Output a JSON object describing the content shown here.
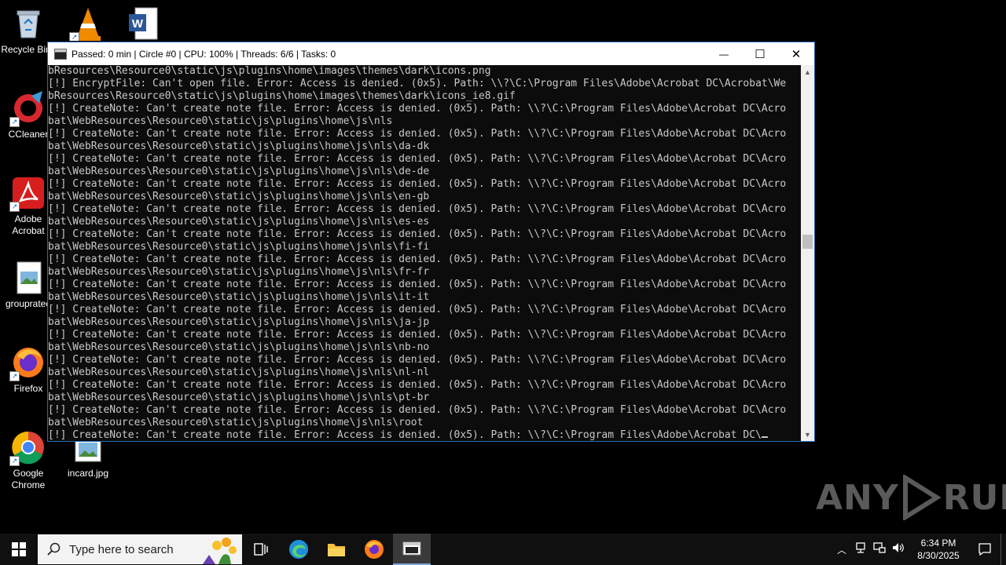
{
  "desktop": {
    "icons": [
      {
        "label": "Recycle Bin"
      },
      {
        "label": "VLC media player"
      },
      {
        "label": "Word document"
      },
      {
        "label": "CCleaner"
      },
      {
        "label": "Adobe Acrobat"
      },
      {
        "label": "grouprated"
      },
      {
        "label": "Firefox"
      },
      {
        "label": "Google Chrome"
      },
      {
        "label": "incard.jpg"
      }
    ]
  },
  "console_window": {
    "title": "Passed: 0 min | Circle #0 | CPU: 100% | Threads: 6/6 | Tasks: 0",
    "minimize_label": "—",
    "maximize_label": "☐",
    "close_label": "✕",
    "lines": [
      "bResources\\Resource0\\static\\js\\plugins\\home\\images\\themes\\dark\\icons.png",
      "[!] EncryptFile: Can't open file. Error: Access is denied. (0x5). Path: \\\\?\\C:\\Program Files\\Adobe\\Acrobat DC\\Acrobat\\We",
      "bResources\\Resource0\\static\\js\\plugins\\home\\images\\themes\\dark\\icons_ie8.gif",
      "[!] CreateNote: Can't create note file. Error: Access is denied. (0x5). Path: \\\\?\\C:\\Program Files\\Adobe\\Acrobat DC\\Acro",
      "bat\\WebResources\\Resource0\\static\\js\\plugins\\home\\js\\nls",
      "[!] CreateNote: Can't create note file. Error: Access is denied. (0x5). Path: \\\\?\\C:\\Program Files\\Adobe\\Acrobat DC\\Acro",
      "bat\\WebResources\\Resource0\\static\\js\\plugins\\home\\js\\nls\\da-dk",
      "[!] CreateNote: Can't create note file. Error: Access is denied. (0x5). Path: \\\\?\\C:\\Program Files\\Adobe\\Acrobat DC\\Acro",
      "bat\\WebResources\\Resource0\\static\\js\\plugins\\home\\js\\nls\\de-de",
      "[!] CreateNote: Can't create note file. Error: Access is denied. (0x5). Path: \\\\?\\C:\\Program Files\\Adobe\\Acrobat DC\\Acro",
      "bat\\WebResources\\Resource0\\static\\js\\plugins\\home\\js\\nls\\en-gb",
      "[!] CreateNote: Can't create note file. Error: Access is denied. (0x5). Path: \\\\?\\C:\\Program Files\\Adobe\\Acrobat DC\\Acro",
      "bat\\WebResources\\Resource0\\static\\js\\plugins\\home\\js\\nls\\es-es",
      "[!] CreateNote: Can't create note file. Error: Access is denied. (0x5). Path: \\\\?\\C:\\Program Files\\Adobe\\Acrobat DC\\Acro",
      "bat\\WebResources\\Resource0\\static\\js\\plugins\\home\\js\\nls\\fi-fi",
      "[!] CreateNote: Can't create note file. Error: Access is denied. (0x5). Path: \\\\?\\C:\\Program Files\\Adobe\\Acrobat DC\\Acro",
      "bat\\WebResources\\Resource0\\static\\js\\plugins\\home\\js\\nls\\fr-fr",
      "[!] CreateNote: Can't create note file. Error: Access is denied. (0x5). Path: \\\\?\\C:\\Program Files\\Adobe\\Acrobat DC\\Acro",
      "bat\\WebResources\\Resource0\\static\\js\\plugins\\home\\js\\nls\\it-it",
      "[!] CreateNote: Can't create note file. Error: Access is denied. (0x5). Path: \\\\?\\C:\\Program Files\\Adobe\\Acrobat DC\\Acro",
      "bat\\WebResources\\Resource0\\static\\js\\plugins\\home\\js\\nls\\ja-jp",
      "[!] CreateNote: Can't create note file. Error: Access is denied. (0x5). Path: \\\\?\\C:\\Program Files\\Adobe\\Acrobat DC\\Acro",
      "bat\\WebResources\\Resource0\\static\\js\\plugins\\home\\js\\nls\\nb-no",
      "[!] CreateNote: Can't create note file. Error: Access is denied. (0x5). Path: \\\\?\\C:\\Program Files\\Adobe\\Acrobat DC\\Acro",
      "bat\\WebResources\\Resource0\\static\\js\\plugins\\home\\js\\nls\\nl-nl",
      "[!] CreateNote: Can't create note file. Error: Access is denied. (0x5). Path: \\\\?\\C:\\Program Files\\Adobe\\Acrobat DC\\Acro",
      "bat\\WebResources\\Resource0\\static\\js\\plugins\\home\\js\\nls\\pt-br",
      "[!] CreateNote: Can't create note file. Error: Access is denied. (0x5). Path: \\\\?\\C:\\Program Files\\Adobe\\Acrobat DC\\Acro",
      "bat\\WebResources\\Resource0\\static\\js\\plugins\\home\\js\\nls\\root",
      "[!] CreateNote: Can't create note file. Error: Access is denied. (0x5). Path: \\\\?\\C:\\Program Files\\Adobe\\Acrobat DC\\"
    ]
  },
  "watermark": {
    "text_left": "ANY",
    "text_right": "RUN"
  },
  "taskbar": {
    "search_placeholder": "Type here to search",
    "time": "6:34 PM",
    "date": "8/30/2025"
  },
  "colors": {
    "console_bg": "#0c0c0c",
    "console_text": "#c8c8c8",
    "taskbar_bg": "#101010"
  }
}
